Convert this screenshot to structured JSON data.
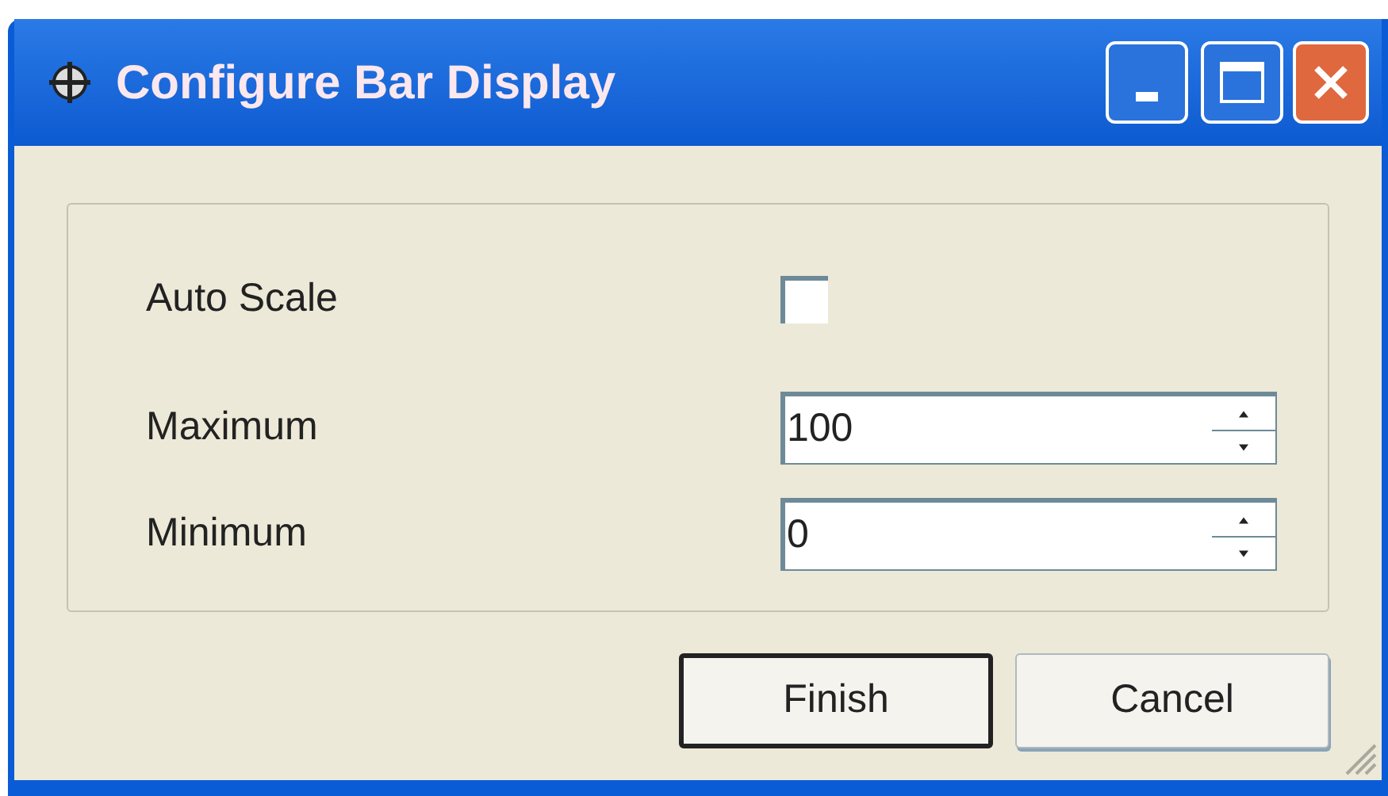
{
  "window": {
    "title": "Configure Bar Display"
  },
  "fields": [
    {
      "kind": "checkbox",
      "label": "Auto Scale",
      "checked": false
    },
    {
      "kind": "spinner",
      "label": "Maximum",
      "value": "100"
    },
    {
      "kind": "spinner",
      "label": "Minimum",
      "value": "0"
    }
  ],
  "buttons": [
    {
      "label": "Finish",
      "default": true
    },
    {
      "label": "Cancel",
      "default": false
    }
  ]
}
